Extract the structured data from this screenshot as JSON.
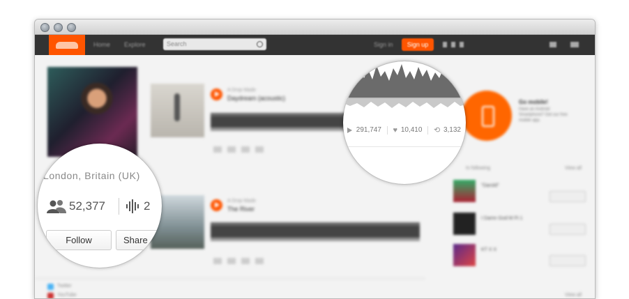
{
  "navbar": {
    "nav_links": [
      "Home",
      "Explore"
    ],
    "search_placeholder": "Search",
    "sign_in": "Sign in",
    "sign_up": "Sign up"
  },
  "tracks": [
    {
      "uploader": "A Drop Made",
      "title": "Daydream (acoustic)"
    },
    {
      "uploader": "A Drop Made",
      "title": "The River"
    }
  ],
  "sidebar": {
    "go_mobile_title": "Go mobile!",
    "go_mobile_text": "Have an Android Smartphone? Get our free mobile app.",
    "following_heading": "In following",
    "view_all": "View all",
    "following": [
      "\"Darold\"",
      "I Damn God M Ft 1",
      "KT X X"
    ],
    "follow_label": "Follow"
  },
  "profile": {
    "location": "London, Britain (UK)",
    "followers": "52,377",
    "tracks": "2",
    "follow_button": "Follow",
    "share_button": "Share",
    "links": [
      "Twitter",
      "YouTube"
    ]
  },
  "track_stats": {
    "plays": "291,747",
    "likes": "10,410",
    "reposts": "3,132"
  },
  "colors": {
    "accent": "#ff5500",
    "navbar": "#333333"
  }
}
